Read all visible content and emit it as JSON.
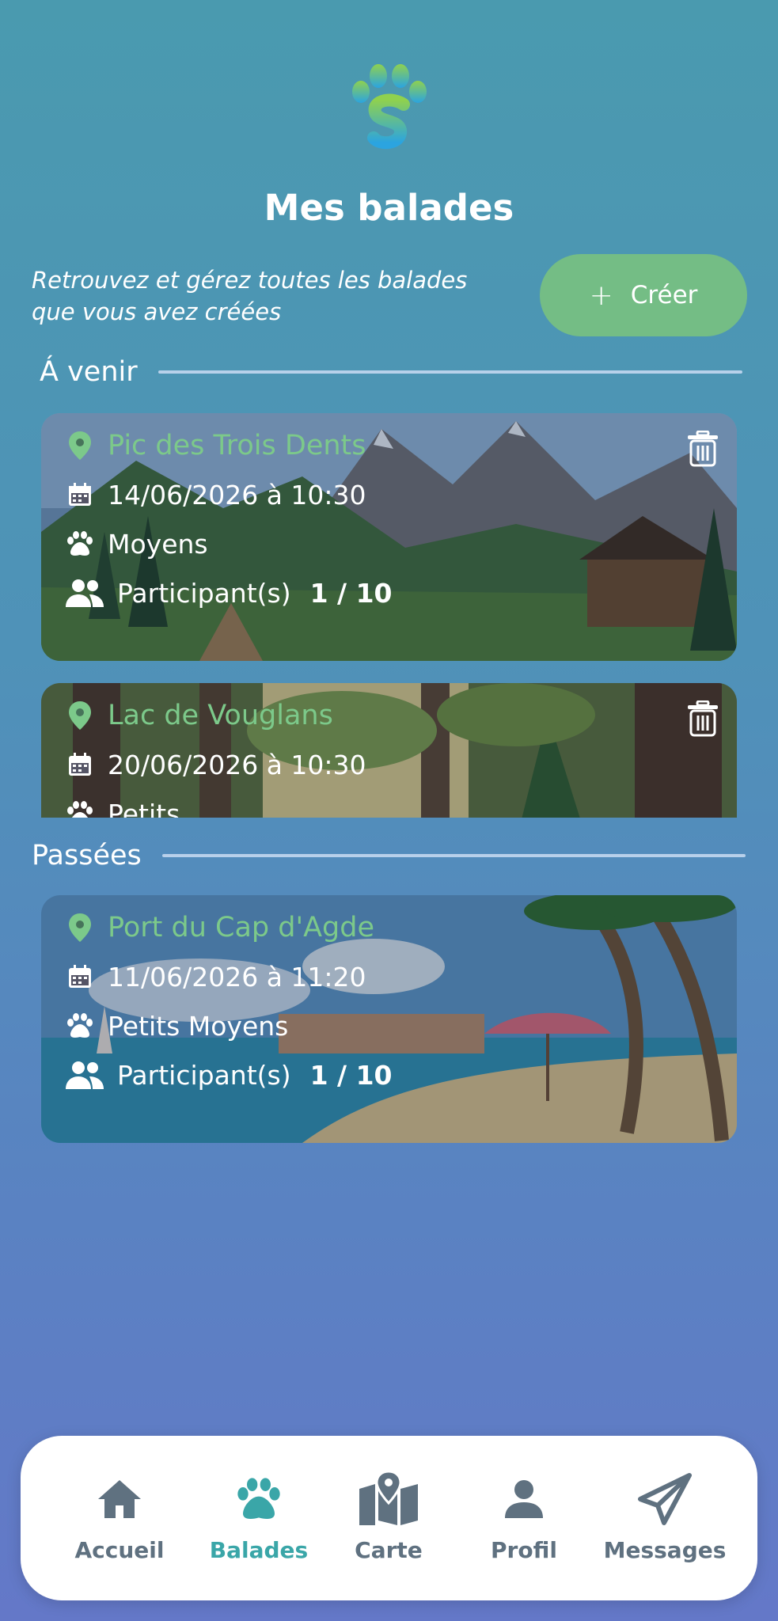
{
  "app": {
    "title": "Mes balades",
    "subtitle": "Retrouvez et gérez toutes les balades que vous avez créées",
    "create_label": "Créer"
  },
  "sections": {
    "upcoming": "Á venir",
    "past": "Passées"
  },
  "walks_upcoming": [
    {
      "place": "Pic des Trois Dents",
      "datetime": "14/06/2026 à 10:30",
      "dog_size": "Moyens",
      "participants_label": "Participant(s)",
      "participants": "1 / 10",
      "image": "mountain-landscape"
    },
    {
      "place": "Lac de Vouglans",
      "datetime": "20/06/2026 à 10:30",
      "dog_size": "Petits",
      "image": "forest-landscape"
    }
  ],
  "walks_past": [
    {
      "place": "Port du Cap d'Agde",
      "datetime": "11/06/2026 à 11:20",
      "dog_size": "Petits Moyens",
      "participants_label": "Participant(s)",
      "participants": "1 / 10",
      "image": "beach-landscape"
    }
  ],
  "nav": [
    {
      "label": "Accueil",
      "icon": "home-icon",
      "active": false
    },
    {
      "label": "Balades",
      "icon": "paw-icon",
      "active": true
    },
    {
      "label": "Carte",
      "icon": "map-icon",
      "active": false
    },
    {
      "label": "Profil",
      "icon": "person-icon",
      "active": false
    },
    {
      "label": "Messages",
      "icon": "send-icon",
      "active": false
    }
  ],
  "colors": {
    "accent_green": "#74bd85",
    "place_green": "#7cc98a",
    "nav_active": "#3aa6a8",
    "nav_inactive": "#5f7180"
  }
}
